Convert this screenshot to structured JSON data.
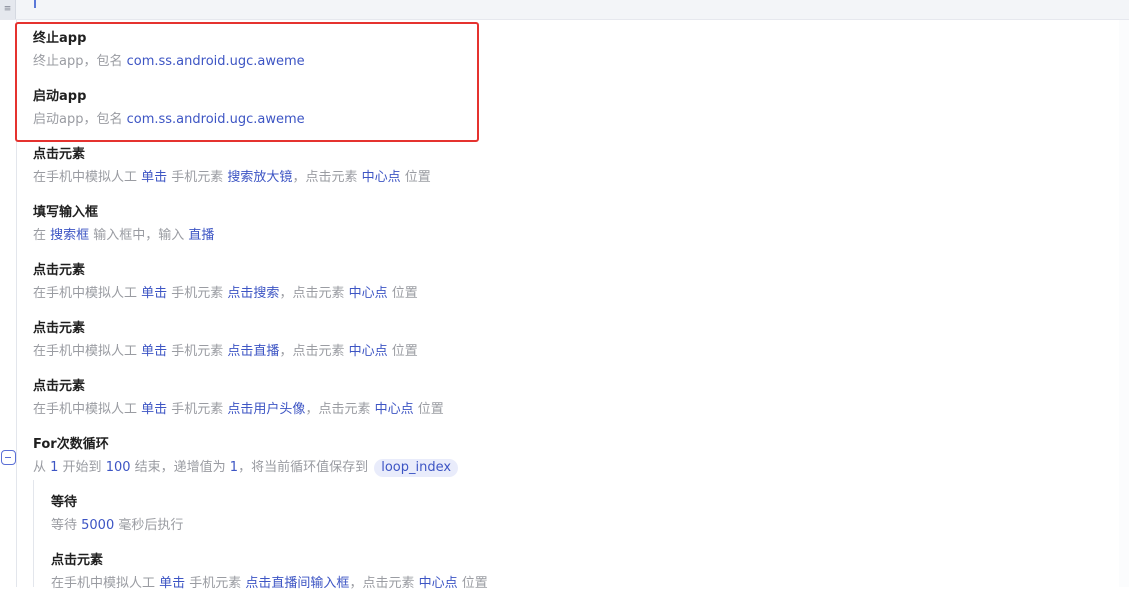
{
  "top_tab_label": "≡",
  "steps": [
    {
      "title": "终止app",
      "desc": [
        {
          "t": "终止app，包名 ",
          "hl": false
        },
        {
          "t": "com.ss.android.ugc.aweme",
          "hl": true
        }
      ]
    },
    {
      "title": "启动app",
      "desc": [
        {
          "t": "启动app，包名 ",
          "hl": false
        },
        {
          "t": "com.ss.android.ugc.aweme",
          "hl": true
        }
      ]
    },
    {
      "title": "点击元素",
      "desc": [
        {
          "t": "在手机中模拟人工 ",
          "hl": false
        },
        {
          "t": "单击",
          "hl": true
        },
        {
          "t": " 手机元素 ",
          "hl": false
        },
        {
          "t": "搜索放大镜",
          "hl": true
        },
        {
          "t": "，点击元素 ",
          "hl": false
        },
        {
          "t": "中心点",
          "hl": true
        },
        {
          "t": " 位置",
          "hl": false
        }
      ]
    },
    {
      "title": "填写输入框",
      "desc": [
        {
          "t": "在 ",
          "hl": false
        },
        {
          "t": "搜索框",
          "hl": true
        },
        {
          "t": " 输入框中，输入 ",
          "hl": false
        },
        {
          "t": "直播",
          "hl": true
        }
      ]
    },
    {
      "title": "点击元素",
      "desc": [
        {
          "t": "在手机中模拟人工 ",
          "hl": false
        },
        {
          "t": "单击",
          "hl": true
        },
        {
          "t": " 手机元素 ",
          "hl": false
        },
        {
          "t": "点击搜索",
          "hl": true
        },
        {
          "t": "，点击元素 ",
          "hl": false
        },
        {
          "t": "中心点",
          "hl": true
        },
        {
          "t": " 位置",
          "hl": false
        }
      ]
    },
    {
      "title": "点击元素",
      "desc": [
        {
          "t": "在手机中模拟人工 ",
          "hl": false
        },
        {
          "t": "单击",
          "hl": true
        },
        {
          "t": " 手机元素 ",
          "hl": false
        },
        {
          "t": "点击直播",
          "hl": true
        },
        {
          "t": "，点击元素 ",
          "hl": false
        },
        {
          "t": "中心点",
          "hl": true
        },
        {
          "t": " 位置",
          "hl": false
        }
      ]
    },
    {
      "title": "点击元素",
      "desc": [
        {
          "t": "在手机中模拟人工 ",
          "hl": false
        },
        {
          "t": "单击",
          "hl": true
        },
        {
          "t": " 手机元素 ",
          "hl": false
        },
        {
          "t": "点击用户头像",
          "hl": true
        },
        {
          "t": "，点击元素 ",
          "hl": false
        },
        {
          "t": "中心点",
          "hl": true
        },
        {
          "t": " 位置",
          "hl": false
        }
      ]
    },
    {
      "title": "For次数循环",
      "desc": [
        {
          "t": "从 ",
          "hl": false
        },
        {
          "t": "1",
          "hl": true
        },
        {
          "t": " 开始到 ",
          "hl": false
        },
        {
          "t": "100",
          "hl": true
        },
        {
          "t": " 结束，递增值为 ",
          "hl": false
        },
        {
          "t": "1",
          "hl": true
        },
        {
          "t": "，将当前循环值保存到 ",
          "hl": false
        },
        {
          "t": "loop_index",
          "hl": true,
          "chip": true
        }
      ]
    },
    {
      "title": "等待",
      "desc": [
        {
          "t": "等待 ",
          "hl": false
        },
        {
          "t": "5000",
          "hl": true
        },
        {
          "t": " 毫秒后执行",
          "hl": false
        }
      ]
    },
    {
      "title": "点击元素",
      "desc": [
        {
          "t": "在手机中模拟人工 ",
          "hl": false
        },
        {
          "t": "单击",
          "hl": true
        },
        {
          "t": " 手机元素 ",
          "hl": false
        },
        {
          "t": "点击直播间输入框",
          "hl": true
        },
        {
          "t": "，点击元素 ",
          "hl": false
        },
        {
          "t": "中心点",
          "hl": true
        },
        {
          "t": " 位置",
          "hl": false
        }
      ]
    }
  ]
}
